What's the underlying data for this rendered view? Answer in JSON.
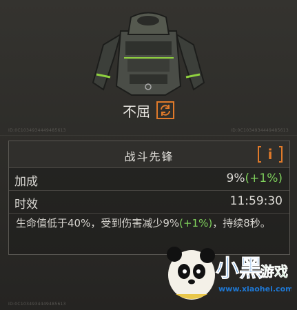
{
  "item": {
    "name": "不屈"
  },
  "codes": [
    "ID:0C1034934449485613",
    "ID:0C1034934449485613",
    "ID:0C1034934449485613"
  ],
  "skill": {
    "title": "战斗先锋",
    "info_label": "i",
    "bonus": {
      "label": "加成",
      "value": "9%",
      "delta": "(+1%)"
    },
    "duration": {
      "label": "时效",
      "value": "11:59:30"
    },
    "description": {
      "prefix": "生命值低于40%，受到伤害减少9%",
      "delta": "(+1%)",
      "suffix": "，持续8秒。"
    }
  },
  "watermark": {
    "brand": "小黑游戏",
    "url": "www.xiaohei.com"
  },
  "icons": [
    "jacket-icon",
    "swap-icon",
    "panda-logo-icon"
  ],
  "colors": {
    "accent": "#e07a2a",
    "positive": "#7fd15c"
  }
}
